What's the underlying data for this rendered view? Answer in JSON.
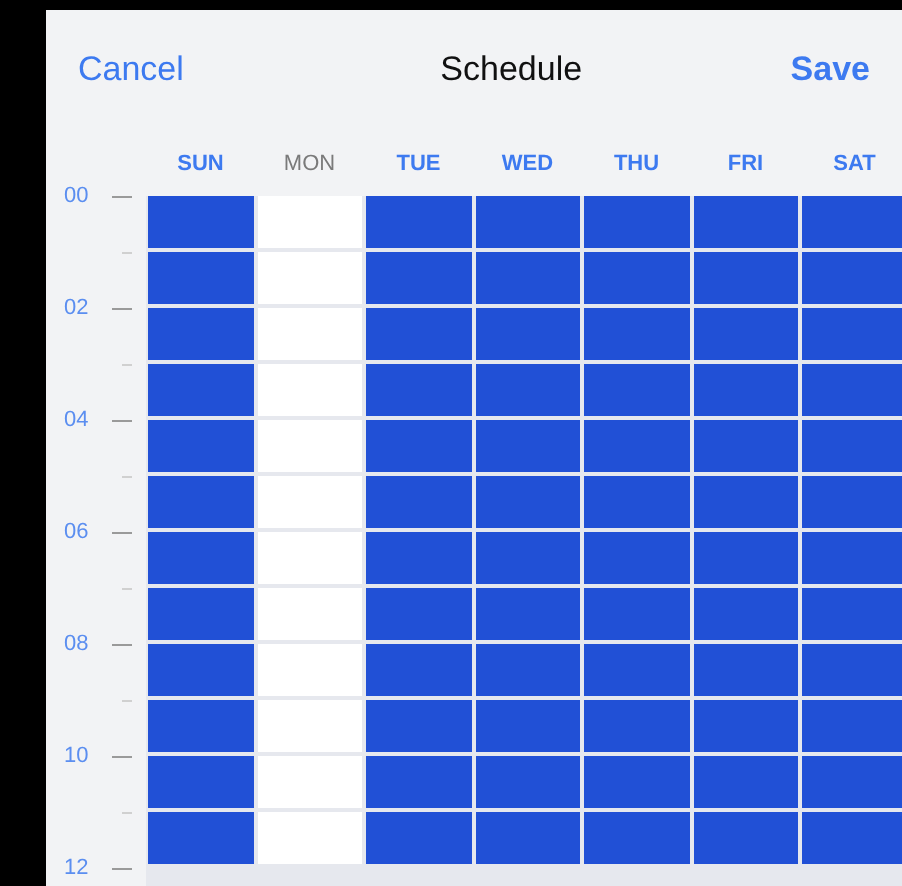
{
  "header": {
    "cancel": "Cancel",
    "title": "Schedule",
    "save": "Save"
  },
  "days": [
    {
      "label": "SUN",
      "active": true
    },
    {
      "label": "MON",
      "active": false
    },
    {
      "label": "TUE",
      "active": true
    },
    {
      "label": "WED",
      "active": true
    },
    {
      "label": "THU",
      "active": true
    },
    {
      "label": "FRI",
      "active": true
    },
    {
      "label": "SAT",
      "active": true
    }
  ],
  "hour_labels": [
    "00",
    "02",
    "04",
    "06",
    "08",
    "10",
    "12"
  ]
}
